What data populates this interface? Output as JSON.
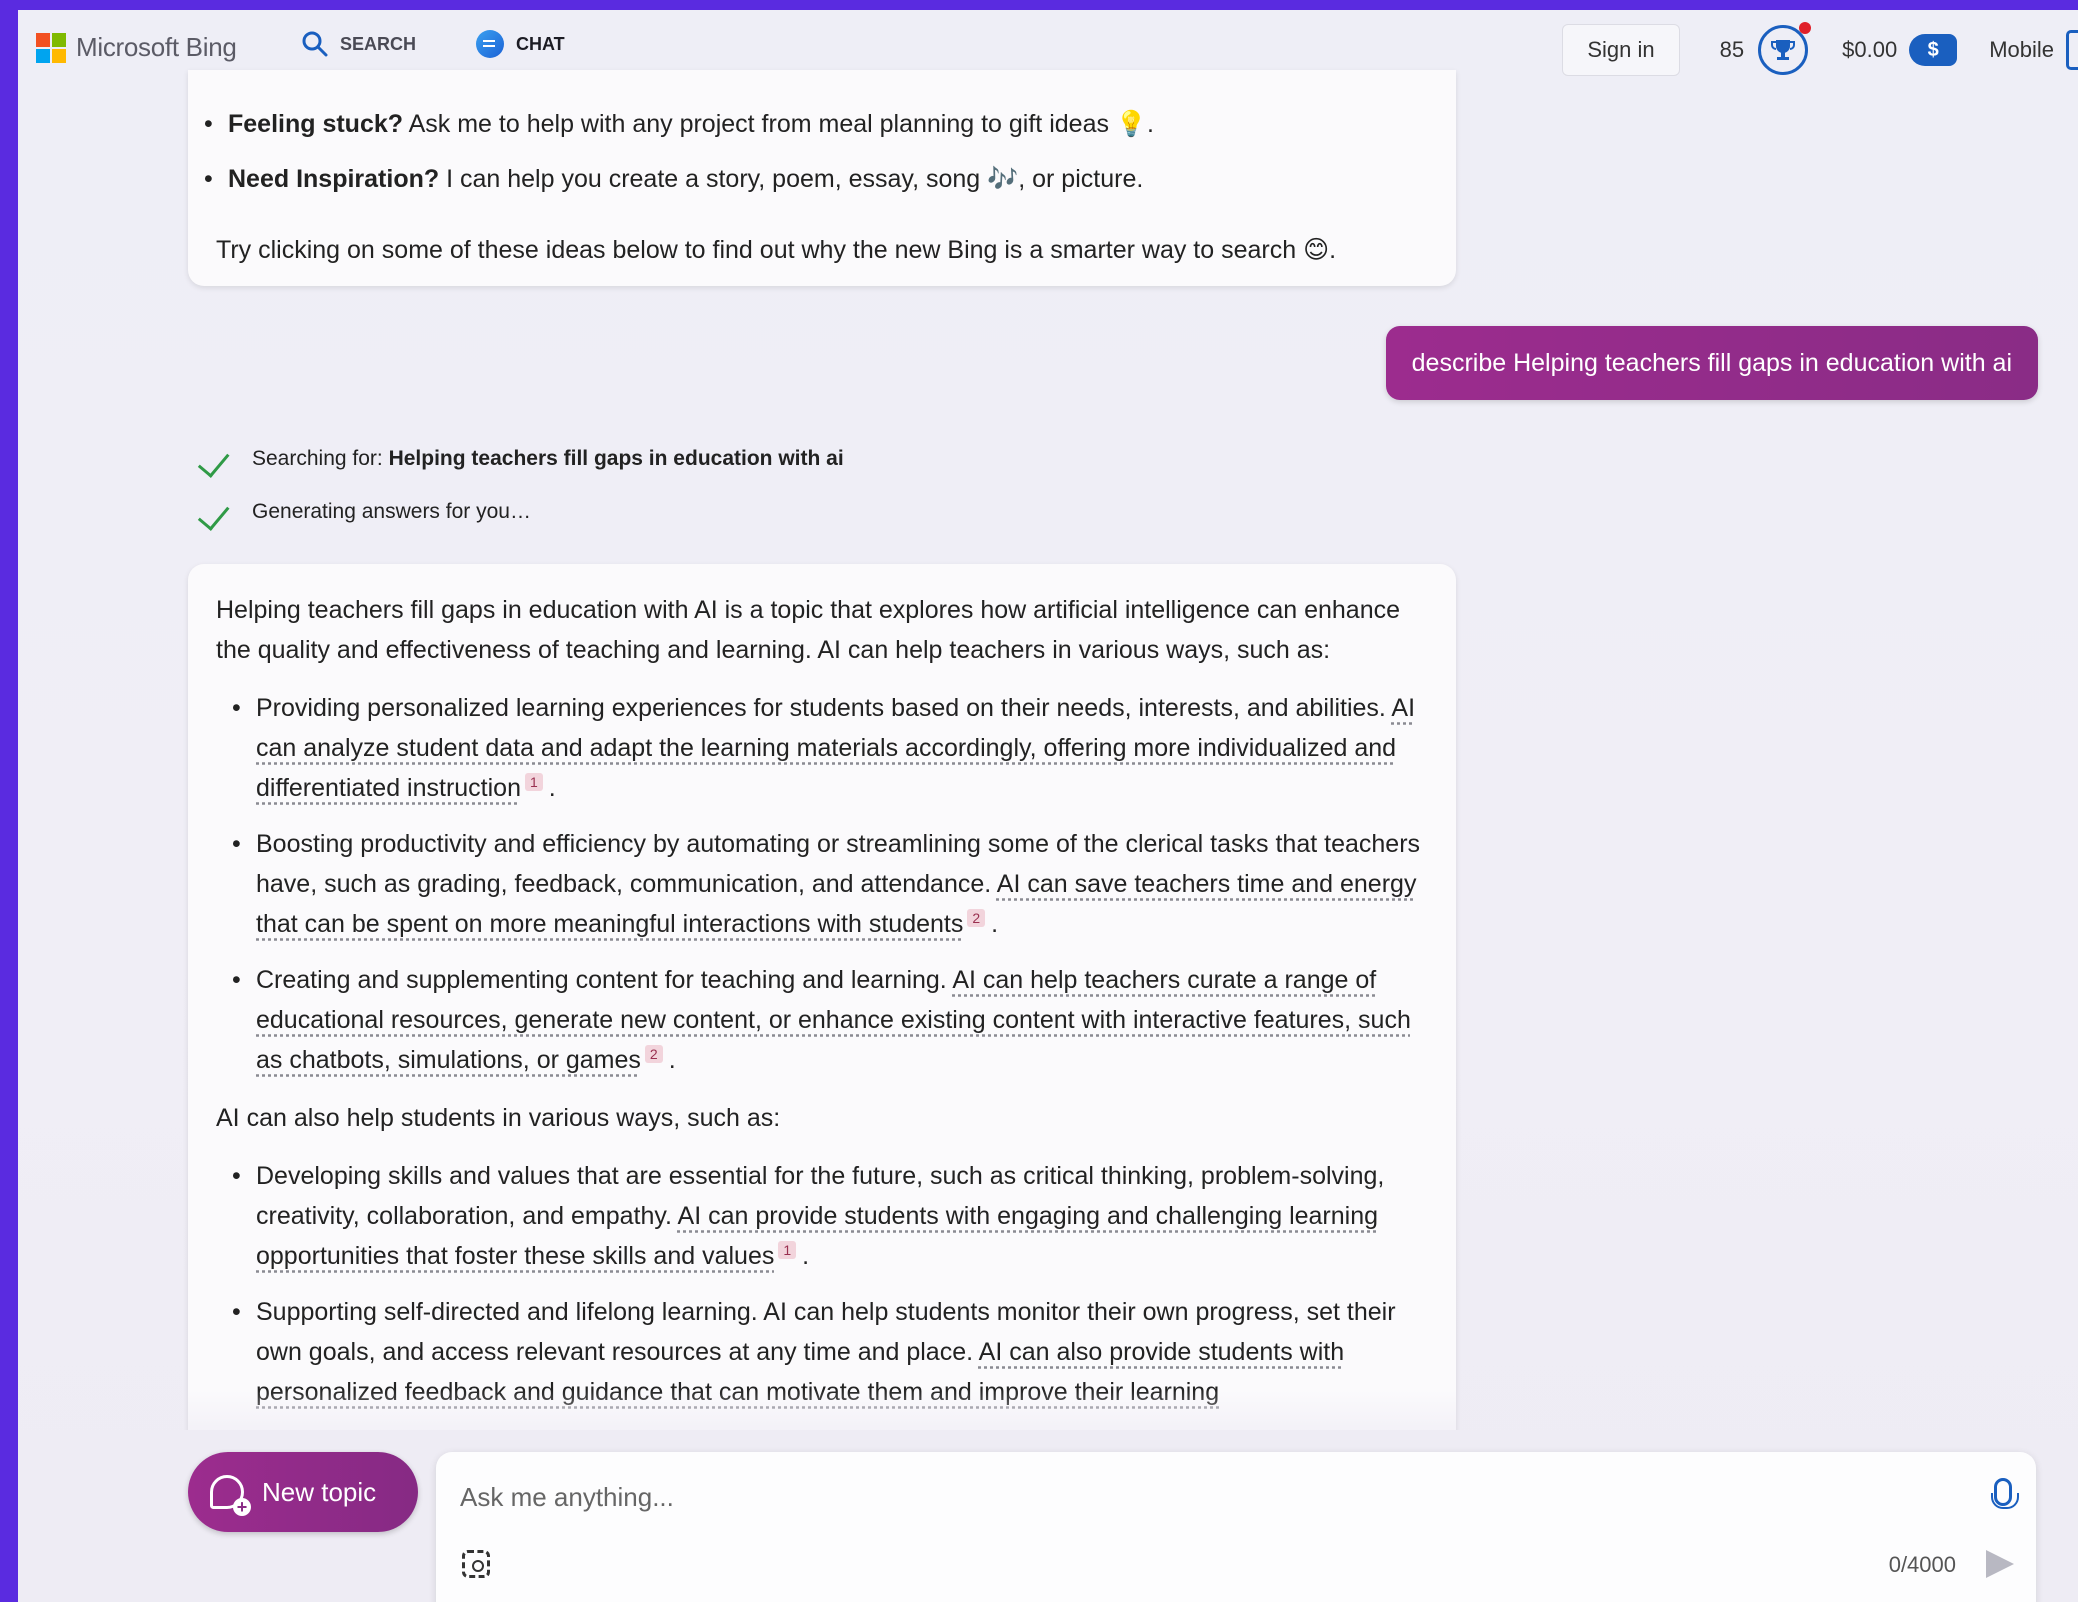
{
  "header": {
    "brand": "Microsoft Bing",
    "nav": [
      {
        "label": "SEARCH",
        "icon": "search-icon",
        "active": false
      },
      {
        "label": "CHAT",
        "icon": "chat-icon",
        "active": true
      }
    ],
    "sign_in": "Sign in",
    "points": "85",
    "cash": "$0.00",
    "dollar_symbol": "$",
    "mobile": "Mobile"
  },
  "intro": {
    "bullet1_bold": "Feeling stuck?",
    "bullet1_text": " Ask me to help with any project from meal planning to gift ideas 💡.",
    "bullet2_bold": "Need Inspiration?",
    "bullet2_text": " I can help you create a story, poem, essay, song 🎶, or picture.",
    "try_text": "Try clicking on some of these ideas below to find out why the new Bing is a smarter way to search 😊."
  },
  "user_message": "describe Helping teachers fill gaps in education with ai",
  "status": {
    "searching_label": "Searching for: ",
    "searching_query": "Helping teachers fill gaps in education with ai",
    "generating": "Generating answers for you…"
  },
  "answer": {
    "intro": "Helping teachers fill gaps in education with AI is a topic that explores how artificial intelligence can enhance the quality and effectiveness of teaching and learning. AI can help teachers in various ways, such as:",
    "teacher_points": [
      {
        "text": "Providing personalized learning experiences for students based on their needs, interests, and abilities. ",
        "cited": "AI can analyze student data and adapt the learning materials accordingly, offering more individualized and differentiated instruction",
        "ref": "1"
      },
      {
        "text": "Boosting productivity and efficiency by automating or streamlining some of the clerical tasks that teachers have, such as grading, feedback, communication, and attendance. ",
        "cited": "AI can save teachers time and energy that can be spent on more meaningful interactions with students",
        "ref": "2"
      },
      {
        "text": "Creating and supplementing content for teaching and learning. ",
        "cited": "AI can help teachers curate a range of educational resources, generate new content, or enhance existing content with interactive features, such as chatbots, simulations, or games",
        "ref": "2"
      }
    ],
    "students_intro": "AI can also help students in various ways, such as:",
    "student_points": [
      {
        "text": "Developing skills and values that are essential for the future, such as critical thinking, problem-solving, creativity, collaboration, and empathy. ",
        "cited": "AI can provide students with engaging and challenging learning opportunities that foster these skills and values",
        "ref": "1"
      },
      {
        "text": "Supporting self-directed and lifelong learning. AI can help students monitor their own progress, set their own goals, and access relevant resources at any time and place. ",
        "cited": "AI can also provide students with personalized feedback and guidance that can motivate them and improve their learning",
        "ref": ""
      }
    ]
  },
  "composer": {
    "new_topic": "New topic",
    "placeholder": "Ask me anything...",
    "counter": "0/4000"
  },
  "colors": {
    "accent": "#1a5fbf",
    "brand_gradient_start": "#9c2c8e",
    "brand_gradient_end": "#862a84",
    "check": "#2f9a46",
    "outer_bg": "#5a2be0"
  }
}
